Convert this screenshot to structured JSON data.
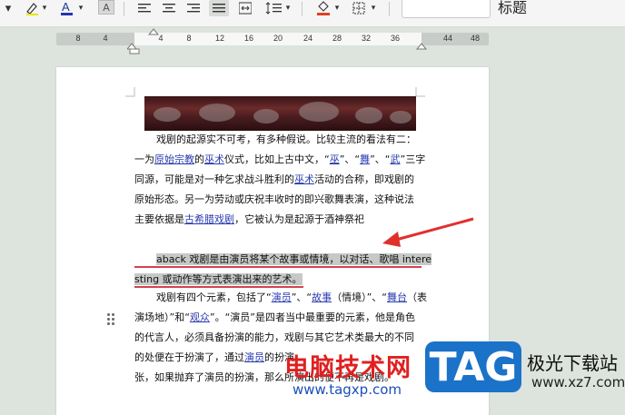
{
  "toolbar": {
    "highlight_icon": "highlighter-icon",
    "font_color_icon": "font-color-icon",
    "char_shading_label": "A",
    "align_icons": [
      "align-left-icon",
      "align-center-icon",
      "align-right-icon",
      "align-justify-icon",
      "distributed-icon",
      "line-spacing-icon"
    ],
    "shading_icon": "paint-bucket-icon",
    "border_icon": "border-icon",
    "style_label": "标题",
    "accent_color": "#e0302c"
  },
  "ruler": {
    "numbers": [
      "8",
      "4",
      "4",
      "8",
      "12",
      "16",
      "20",
      "24",
      "28",
      "32",
      "36",
      "44",
      "48"
    ]
  },
  "document": {
    "p1": {
      "l1": "戏剧的起源实不可考，有多种假说。比较主流的看法有二：",
      "l2": [
        "一为",
        "原始宗教",
        "的",
        "巫术",
        "仪式，比如上古中文，“",
        "巫",
        "”、“",
        "舞",
        "”、“",
        "武",
        "”三字"
      ],
      "l3": [
        "同源，可能是对一种乞求战斗胜利的",
        "巫术",
        "活动的合称，即戏剧的"
      ],
      "l4": "原始形态。另一为劳动或庆祝丰收时的即兴歌舞表演，这种说法",
      "l5": [
        "主要依据是",
        "古希腊",
        "戏剧",
        "，它被认为是起源于酒神祭祀"
      ]
    },
    "p2": {
      "l1": "aback 戏剧是由演员将某个故事或情境，以对话、歌唱 intere",
      "l2": "sting 或动作等方式表演出来的艺术。"
    },
    "p3": {
      "l1": [
        "戏剧有四个元素，包括了“",
        "演员",
        "”、“",
        "故事",
        "（情境）”、“",
        "舞台",
        "（表"
      ],
      "l2": [
        "演场地）”和“",
        "观众",
        "”。“演员”是四者当中最重要的元素，他是角色"
      ],
      "l3": "的代言人，必须具备扮演的能力，戏剧与其它艺术类最大的不同",
      "l4": [
        "的处便在于扮演了，通过",
        "演员",
        "的扮演"
      ],
      "l5": "张，如果抛弃了演员的扮演，那么所演出的便不再是戏剧。"
    }
  },
  "watermark": {
    "title": "电脑技术网",
    "url": "www.tagxp.com",
    "badge": "TAG",
    "site_name": "极光下载站",
    "site_url": "www.xz7.com"
  }
}
